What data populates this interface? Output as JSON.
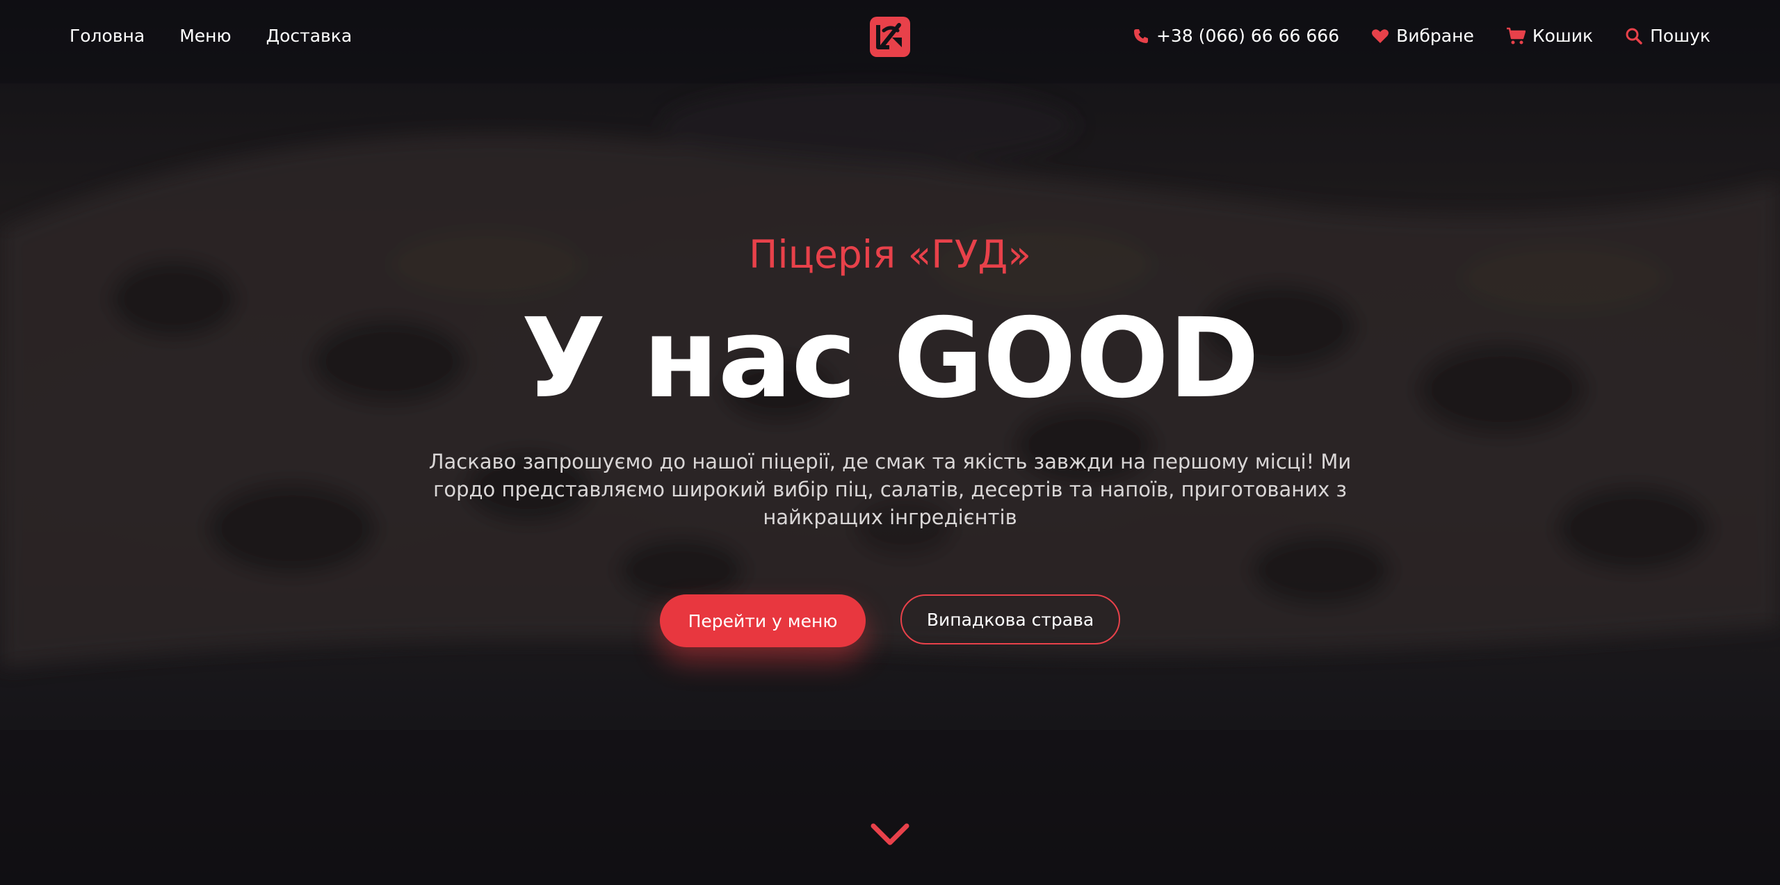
{
  "nav": {
    "left_links": [
      {
        "label": "Головна"
      },
      {
        "label": "Меню"
      },
      {
        "label": "Доставка"
      }
    ],
    "phone": {
      "icon": "phone-icon",
      "label": "+38 (066) 66 66 666"
    },
    "favorites": {
      "icon": "heart-icon",
      "label": "Вибране"
    },
    "cart": {
      "icon": "cart-icon",
      "label": "Кошик"
    },
    "search": {
      "icon": "search-icon",
      "label": "Пошук"
    }
  },
  "logo": {
    "icon": "pizza-logo-icon"
  },
  "hero": {
    "subtitle": "Піцерія «ГУД»",
    "headline": "У нас GOOD",
    "description": "Ласкаво запрошуємо до нашої піцерії, де смак та якість завжди на першому місці! Ми гордо представляємо широкий вибір піц, салатів, десертів та напоїв, приготованих з найкращих інгредієнтів",
    "primary_button": "Перейти у меню",
    "secondary_button": "Випадкова страва",
    "scroll_icon": "chevron-down-icon"
  },
  "colors": {
    "accent": "#e8414a",
    "button": "#e8373f",
    "background": "#131217",
    "text": "#ffffff"
  }
}
